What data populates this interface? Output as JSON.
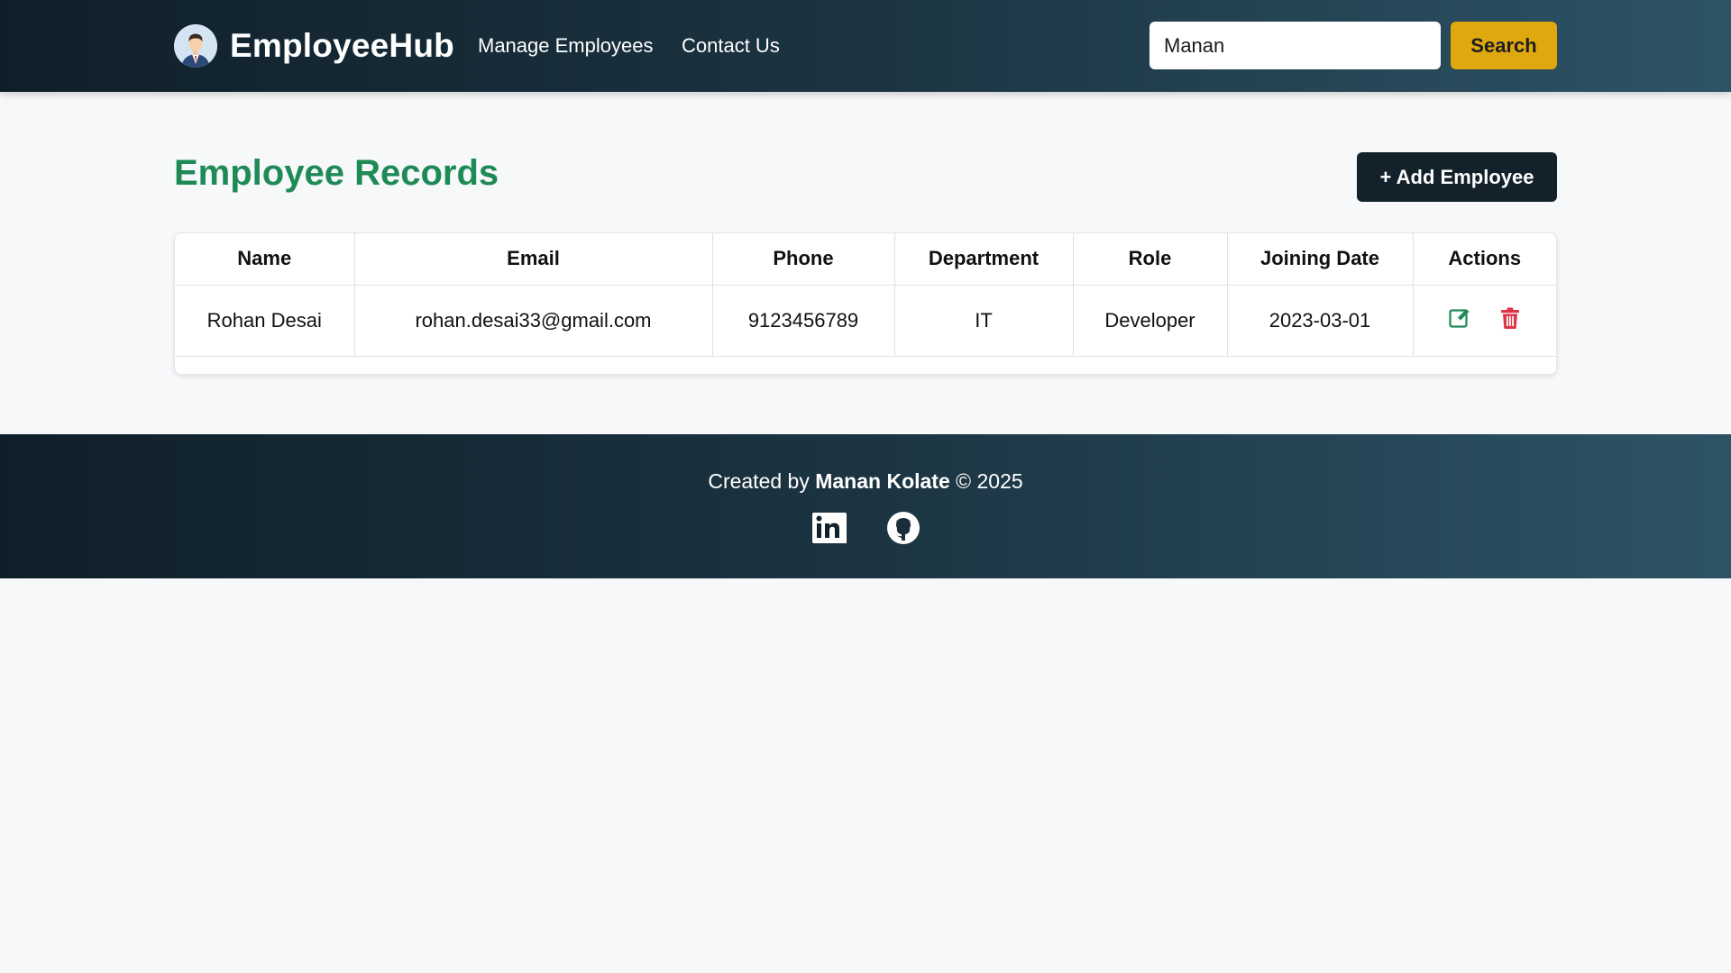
{
  "header": {
    "brand": "EmployeeHub",
    "nav": [
      "Manage Employees",
      "Contact Us"
    ],
    "search": {
      "value": "Manan",
      "button_label": "Search"
    }
  },
  "main": {
    "title": "Employee Records",
    "add_button_label": "+ Add Employee",
    "table": {
      "columns": [
        "Name",
        "Email",
        "Phone",
        "Department",
        "Role",
        "Joining Date",
        "Actions"
      ],
      "rows": [
        {
          "name": "Rohan Desai",
          "email": "rohan.desai33@gmail.com",
          "phone": "9123456789",
          "department": "IT",
          "role": "Developer",
          "joining_date": "2023-03-01",
          "actions": [
            "edit-icon",
            "trash-icon"
          ]
        }
      ]
    }
  },
  "footer": {
    "prefix": "Created by",
    "author": "Manan Kolate",
    "suffix": "© 2025",
    "social_icons": [
      "linkedin-icon",
      "github-icon"
    ]
  },
  "colors": {
    "header_gradient": [
      "#0f1f29",
      "#2d5466"
    ],
    "title": "#1e8a55",
    "search_button": "#e0a80f",
    "add_button": "#13212b",
    "edit_icon": "#1e8a55",
    "delete_icon": "#dc3545"
  }
}
